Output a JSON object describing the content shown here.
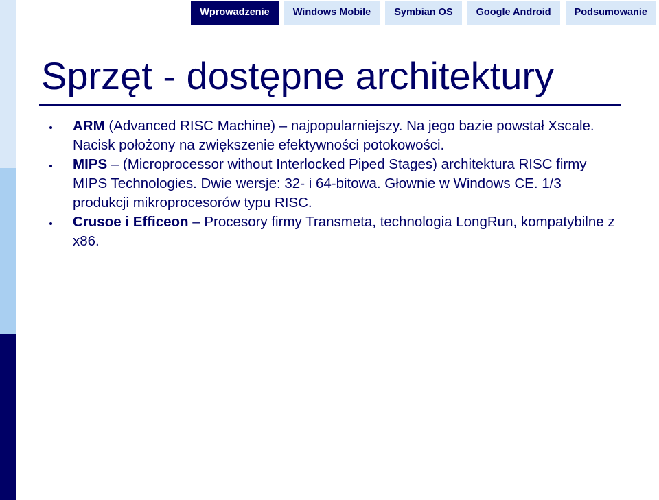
{
  "nav": {
    "tabs": [
      {
        "label": "Wprowadzenie",
        "active": true
      },
      {
        "label": "Windows Mobile",
        "active": false
      },
      {
        "label": "Symbian OS",
        "active": false
      },
      {
        "label": "Google Android",
        "active": false
      },
      {
        "label": "Podsumowanie",
        "active": false
      }
    ]
  },
  "slide": {
    "title": "Sprzęt - dostępne architektury",
    "bullets": [
      {
        "term": "ARM",
        "text": " (Advanced RISC Machine) – najpopularniejszy. Na jego bazie powstał Xscale. Nacisk położony na zwiększenie efektywności potokowości."
      },
      {
        "term": "MIPS",
        "text": " – (Microprocessor without Interlocked Piped Stages) architektura RISC firmy MIPS Technologies. Dwie wersje: 32- i 64-bitowa. Głownie w Windows CE. 1/3 produkcji mikroprocesorów typu RISC."
      },
      {
        "term": "Crusoe i Efficeon",
        "text": " – Procesory firmy Transmeta, technologia LongRun, kompatybilne z x86."
      }
    ]
  },
  "colors": {
    "accent_dark": "#000066",
    "tab_light": "#d9e8f8",
    "bar_mid": "#a9cff1"
  }
}
